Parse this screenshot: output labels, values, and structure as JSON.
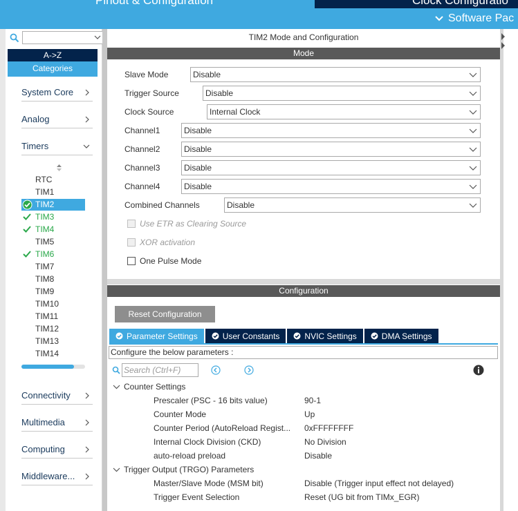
{
  "top": {
    "tab_left": "Pinout & Configuration",
    "tab_right": "Clock Configuratio",
    "software_packs": "Software Pac"
  },
  "left": {
    "az_label": "A->Z",
    "categories_label": "Categories",
    "categories": [
      {
        "label": "System Core"
      },
      {
        "label": "Analog"
      },
      {
        "label": "Timers"
      },
      {
        "label": "Connectivity"
      },
      {
        "label": "Multimedia"
      },
      {
        "label": "Computing"
      },
      {
        "label": "Middleware..."
      }
    ],
    "peripherals": [
      {
        "label": "RTC",
        "state": "none"
      },
      {
        "label": "TIM1",
        "state": "none"
      },
      {
        "label": "TIM2",
        "state": "selected"
      },
      {
        "label": "TIM3",
        "state": "ok"
      },
      {
        "label": "TIM4",
        "state": "ok"
      },
      {
        "label": "TIM5",
        "state": "none"
      },
      {
        "label": "TIM6",
        "state": "ok"
      },
      {
        "label": "TIM7",
        "state": "none"
      },
      {
        "label": "TIM8",
        "state": "none"
      },
      {
        "label": "TIM9",
        "state": "none"
      },
      {
        "label": "TIM10",
        "state": "none"
      },
      {
        "label": "TIM11",
        "state": "none"
      },
      {
        "label": "TIM12",
        "state": "none"
      },
      {
        "label": "TIM13",
        "state": "none"
      },
      {
        "label": "TIM14",
        "state": "none"
      }
    ],
    "scroll_fraction": 0.83
  },
  "main": {
    "title": "TIM2 Mode and Configuration",
    "mode_header": "Mode",
    "config_header": "Configuration",
    "mode_fields": [
      {
        "label": "Slave Mode",
        "value": "Disable"
      },
      {
        "label": "Trigger Source",
        "value": "Disable"
      },
      {
        "label": "Clock Source",
        "value": "Internal Clock"
      },
      {
        "label": "Channel1",
        "value": "Disable"
      },
      {
        "label": "Channel2",
        "value": "Disable"
      },
      {
        "label": "Channel3",
        "value": "Disable"
      },
      {
        "label": "Channel4",
        "value": "Disable"
      },
      {
        "label": "Combined Channels",
        "value": "Disable"
      }
    ],
    "checkboxes": [
      {
        "label": "Use ETR as Clearing Source",
        "enabled": false,
        "checked": false
      },
      {
        "label": "XOR activation",
        "enabled": false,
        "checked": false
      },
      {
        "label": "One Pulse Mode",
        "enabled": true,
        "checked": false
      }
    ],
    "reset_button": "Reset Configuration",
    "tabs": [
      {
        "label": "Parameter Settings",
        "active": true
      },
      {
        "label": "User Constants",
        "active": false
      },
      {
        "label": "NVIC Settings",
        "active": false
      },
      {
        "label": "DMA Settings",
        "active": false
      }
    ],
    "description": "Configure the below parameters :",
    "search_placeholder": "Search (Ctrl+F)",
    "groups": [
      {
        "label": "Counter Settings",
        "params": [
          {
            "name": "Prescaler (PSC - 16 bits value)",
            "value": "90-1"
          },
          {
            "name": "Counter Mode",
            "value": "Up"
          },
          {
            "name": "Counter Period (AutoReload Regist...",
            "value": "0xFFFFFFFF"
          },
          {
            "name": "Internal Clock Division (CKD)",
            "value": "No Division"
          },
          {
            "name": "auto-reload preload",
            "value": "Disable"
          }
        ]
      },
      {
        "label": "Trigger Output (TRGO) Parameters",
        "params": [
          {
            "name": "Master/Slave Mode (MSM bit)",
            "value": "Disable (Trigger input effect not delayed)"
          },
          {
            "name": "Trigger Event Selection",
            "value": "Reset (UG bit from TIMx_EGR)"
          }
        ]
      }
    ]
  },
  "colors": {
    "accent_blue": "#3fa9e0",
    "navy": "#03234b",
    "section_gray": "#595959",
    "ok_green": "#2aa84a"
  }
}
